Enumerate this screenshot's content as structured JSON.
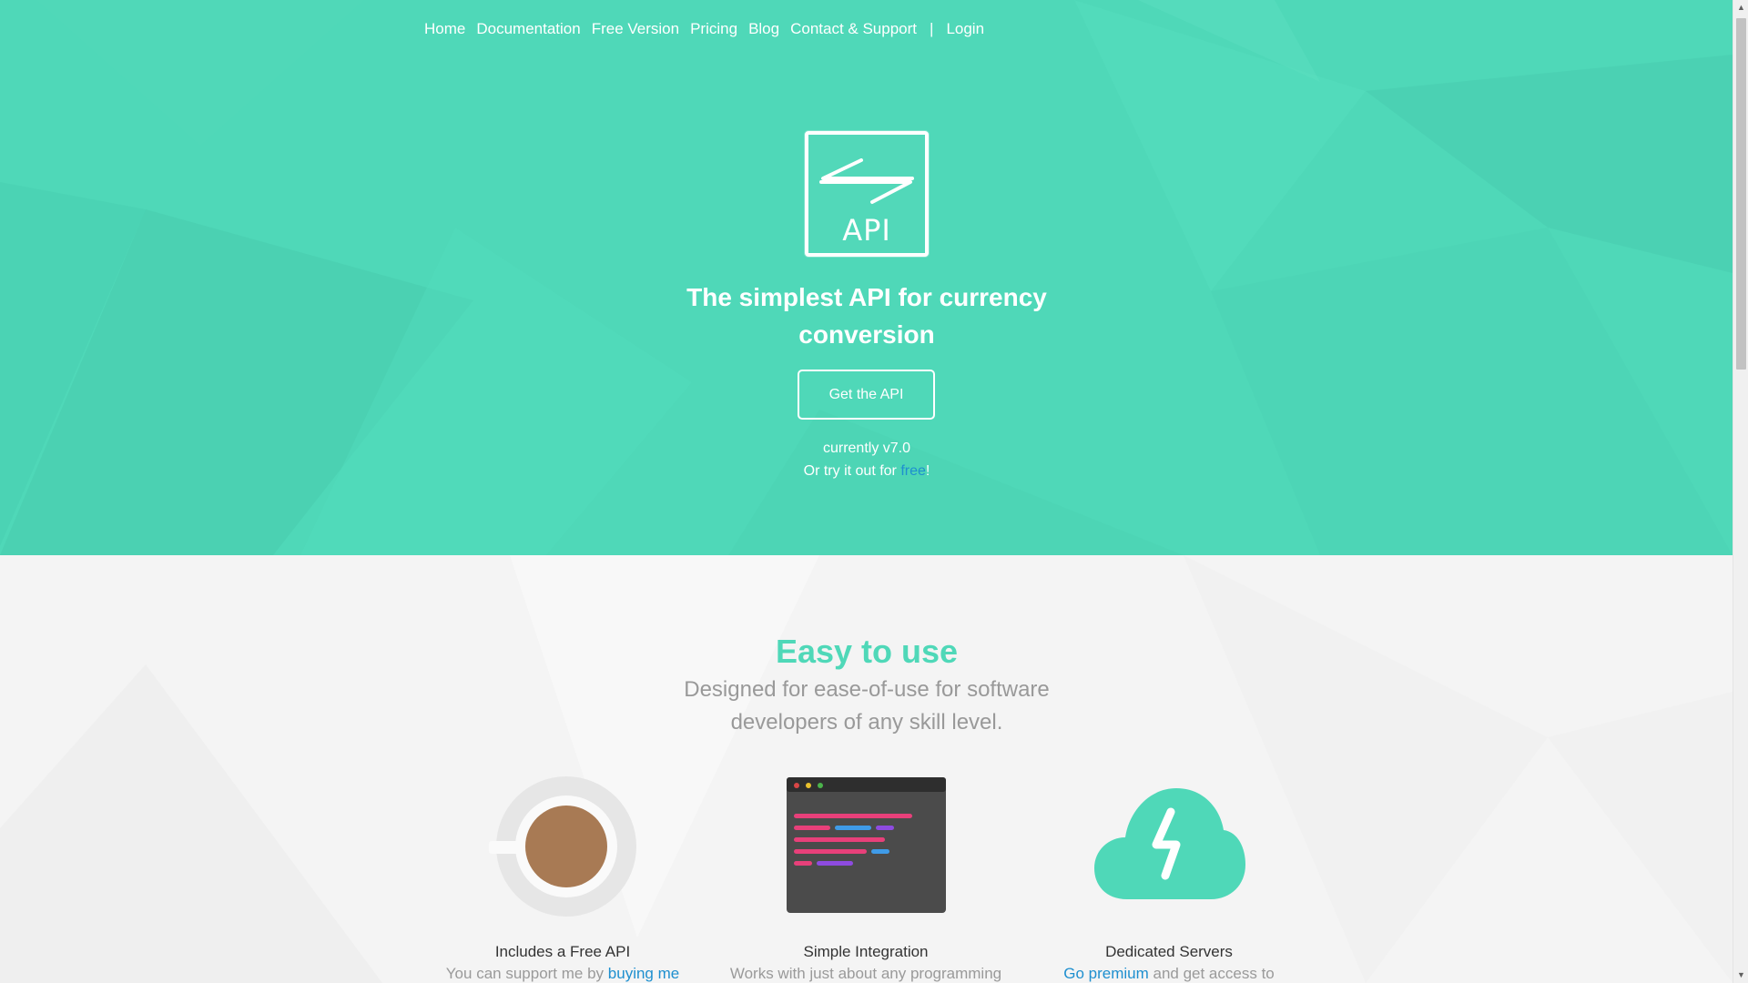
{
  "nav": {
    "items": [
      "Home",
      "Documentation",
      "Free Version",
      "Pricing",
      "Blog",
      "Contact & Support"
    ],
    "separator": "|",
    "login": "Login"
  },
  "hero": {
    "logo_text": "API",
    "tagline": "The simplest API for currency conversion",
    "cta_label": "Get the API",
    "version": "currently v7.0",
    "try_prefix": "Or try it out for ",
    "try_link": "free",
    "try_suffix": "!"
  },
  "features": {
    "title": "Easy to use",
    "subtitle": "Designed for ease-of-use for software developers of any skill level.",
    "cards": [
      {
        "icon": "coffee-cup-icon",
        "title": "Includes a Free API",
        "desc_prefix": "You can support me by ",
        "desc_link": "buying me",
        "desc_suffix": ""
      },
      {
        "icon": "code-editor-icon",
        "title": "Simple Integration",
        "desc_prefix": "Works with just about any programming",
        "desc_link": "",
        "desc_suffix": ""
      },
      {
        "icon": "cloud-lightning-icon",
        "title": "Dedicated Servers",
        "desc_prefix": "",
        "desc_link": "Go premium",
        "desc_suffix": " and get access to"
      }
    ]
  },
  "colors": {
    "brand": "#4fd8b8",
    "link": "#1e8fcf",
    "muted_text": "#999999"
  }
}
